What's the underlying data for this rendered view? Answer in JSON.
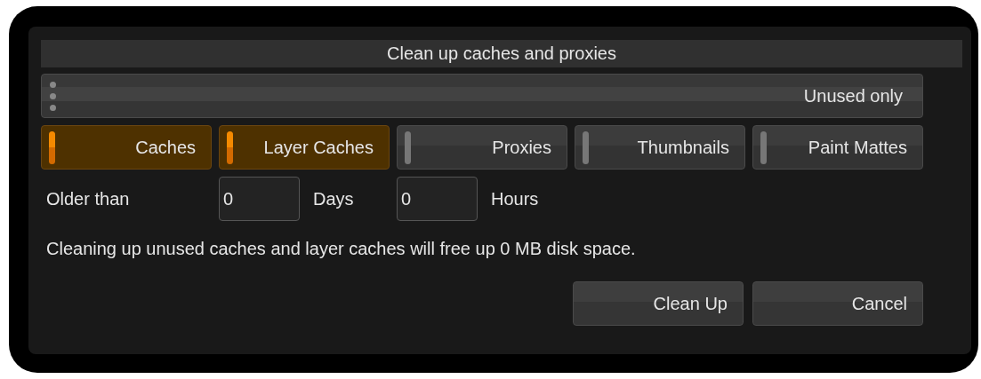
{
  "window": {
    "title": "Clean up caches and proxies"
  },
  "mode_dropdown": {
    "value": "Unused only"
  },
  "toggles": [
    {
      "label": "Caches",
      "checked": true
    },
    {
      "label": "Layer Caches",
      "checked": true
    },
    {
      "label": "Proxies",
      "checked": false
    },
    {
      "label": "Thumbnails",
      "checked": false
    },
    {
      "label": "Paint Mattes",
      "checked": false
    }
  ],
  "age_filter": {
    "label": "Older than",
    "fields": [
      {
        "value": "0",
        "unit": "Days"
      },
      {
        "value": "0",
        "unit": "Hours"
      }
    ]
  },
  "message": "Cleaning up unused caches and layer caches will free up 0 MB disk space.",
  "buttons": [
    "Clean Up",
    "Cancel"
  ]
}
